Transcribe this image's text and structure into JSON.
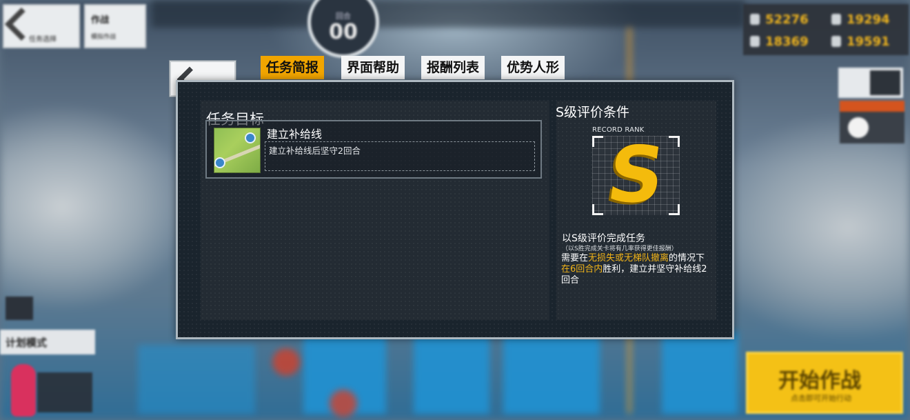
{
  "hud": {
    "back_label": "任务选择",
    "mission_label": "作战",
    "mission_sub": "模拟作战",
    "turn_label": "回合",
    "turn_value": "00",
    "resources": {
      "manpower": "52276",
      "ammo": "19294",
      "rations": "18369",
      "parts": "19591"
    },
    "plan_mode_label": "计划模式",
    "start_battle_label": "开始作战",
    "start_battle_sub": "点击即可开始行动"
  },
  "tabs": [
    {
      "label": "任务简报",
      "active": true
    },
    {
      "label": "界面帮助",
      "active": false
    },
    {
      "label": "报酬列表",
      "active": false
    },
    {
      "label": "优势人形",
      "active": false
    }
  ],
  "objectives": {
    "title": "任务目标",
    "items": [
      {
        "name": "建立补给线",
        "description": "建立补给线后坚守2回合"
      }
    ]
  },
  "rank": {
    "title": "S级评价条件",
    "record_label": "RECORD RANK",
    "grade": "S",
    "condition_title": "以S级评价完成任务",
    "condition_subtitle": "（以S胜完成关卡将有几率获得更佳报酬）",
    "condition_parts": {
      "p1": "需要在",
      "p2": "无损失或无梯队撤离",
      "p3": "的情况下",
      "p4": "在6回合内",
      "p5": "胜利，建立并坚守补给线2回合"
    }
  },
  "colors": {
    "tab_active": "#f1a500",
    "highlight": "#f2b418",
    "rank_letter": "#f4bb0c"
  }
}
